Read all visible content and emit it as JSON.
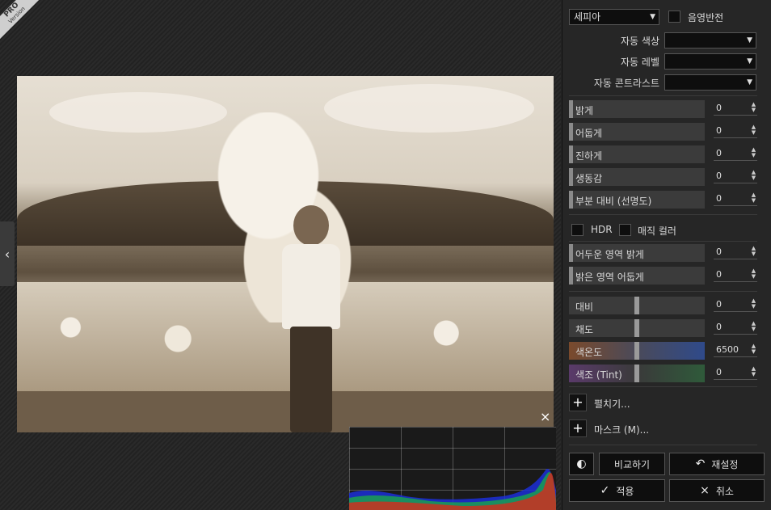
{
  "badge": {
    "pro": "PRO",
    "version": "Version"
  },
  "filter": {
    "preset": "세피아",
    "invert_label": "음영반전"
  },
  "auto": [
    {
      "label": "자동 색상",
      "value": ""
    },
    {
      "label": "자동 레벨",
      "value": ""
    },
    {
      "label": "자동 콘트라스트",
      "value": ""
    }
  ],
  "adjust_sliders": [
    {
      "label": "밝게",
      "value": "0"
    },
    {
      "label": "어둡게",
      "value": "0"
    },
    {
      "label": "진하게",
      "value": "0"
    },
    {
      "label": "생동감",
      "value": "0"
    },
    {
      "label": "부분 대비 (선명도)",
      "value": "0"
    }
  ],
  "toggles": {
    "hdr": "HDR",
    "magic_color": "매직 컬러"
  },
  "region_sliders": [
    {
      "label": "어두운 영역 밝게",
      "value": "0"
    },
    {
      "label": "밝은 영역 어둡게",
      "value": "0"
    }
  ],
  "color_sliders": [
    {
      "label": "대비",
      "value": "0",
      "level": 0.5
    },
    {
      "label": "채도",
      "value": "0",
      "level": 0.5
    },
    {
      "label": "색온도",
      "value": "6500",
      "level": 0.5
    },
    {
      "label": "색조 (Tint)",
      "value": "0",
      "level": 0.5
    }
  ],
  "expand": {
    "more": "펼치기...",
    "mask": "마스크 (M)..."
  },
  "buttons": {
    "compare": "비교하기",
    "reset": "재설정",
    "apply": "적용",
    "cancel": "취소"
  },
  "icons": {
    "close": "×",
    "chevron": "‹",
    "check": "✓",
    "undo": "↶"
  }
}
